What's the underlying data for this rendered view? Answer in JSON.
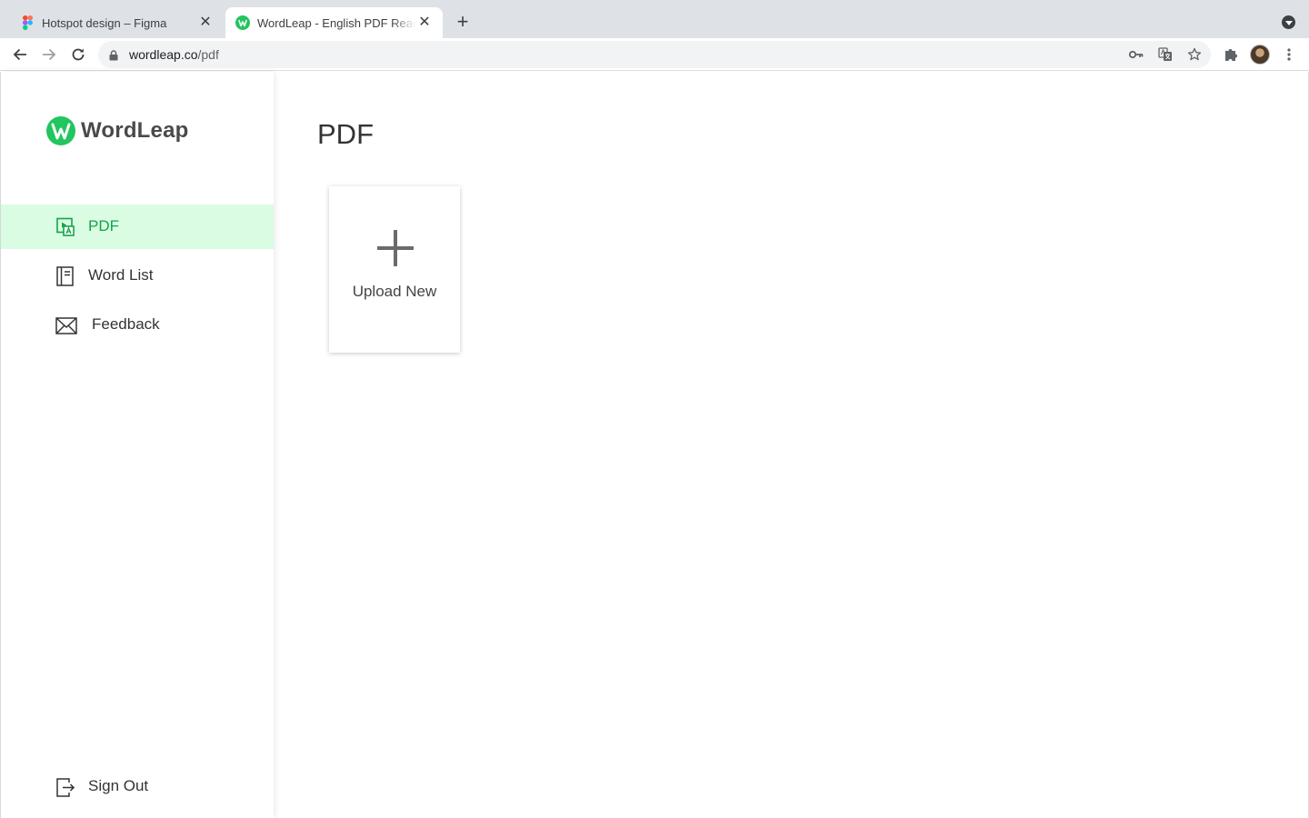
{
  "browser": {
    "tabs": [
      {
        "title": "Hotspot design – Figma",
        "icon": "figma-icon",
        "active": false
      },
      {
        "title": "WordLeap - English PDF Reading",
        "icon": "wordleap-icon",
        "active": true
      }
    ],
    "url_host": "wordleap.co",
    "url_path": "/pdf"
  },
  "app": {
    "brand": "WordLeap",
    "accent_color": "#22c55e",
    "active_bg": "#d9fce3",
    "nav": {
      "pdf": "PDF",
      "word_list": "Word List",
      "feedback": "Feedback",
      "sign_out": "Sign Out"
    }
  },
  "main": {
    "title": "PDF",
    "upload_label": "Upload New"
  }
}
